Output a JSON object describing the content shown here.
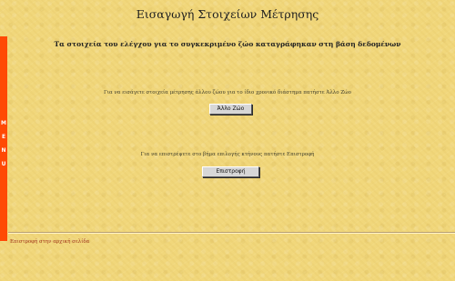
{
  "page": {
    "title": "Εισαγωγή Στοιχείων Μέτρησης",
    "subtitle": "Τα στοιχεία του ελέγχου για το συγκεκριμένο ζώο καταγράφηκαν στη βάση δεδομένων"
  },
  "side_menu": {
    "letters": [
      "M",
      "E",
      "N",
      "U"
    ],
    "color": "#ff4a05"
  },
  "section_other_zone": {
    "instruction": "Για να εισάγετε στοιχεία μέτρησης άλλου ζώου για το ίδιο χρονικό διάστημα πατήστε Άλλο Ζώο",
    "button_label": "Άλλο Ζώο"
  },
  "section_back": {
    "instruction": "Για να επιστρέψετε στο βήμα επιλογής κτήνους πατήστε Επιστροφή",
    "button_label": "Επιστροφή"
  },
  "footer": {
    "link_text": "Επιστροφή στην αρχική σελίδα"
  },
  "colors": {
    "background": "#f1d77b",
    "menu_bar": "#ff4a05",
    "footer_link": "#a0341a"
  }
}
